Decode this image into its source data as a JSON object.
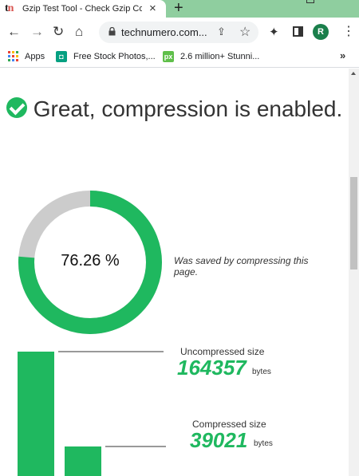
{
  "browser": {
    "tab": {
      "favicon_text": "tn",
      "title": "Gzip Test Tool - Check Gzip Co",
      "close_glyph": "×"
    },
    "new_tab_glyph": "+",
    "nav": {
      "back_glyph": "←",
      "forward_glyph": "→",
      "reload_glyph": "↻",
      "home_glyph": "⌂"
    },
    "url": "technumero.com...",
    "avatar_letter": "R",
    "bookmarks": [
      {
        "label": "Apps"
      },
      {
        "label": "Free Stock Photos,..."
      },
      {
        "label": "2.6 million+ Stunni..."
      }
    ],
    "bookmarks_more": "»"
  },
  "result": {
    "headline": "Great, compression is enabled.",
    "saved_percent_label": "76.26 %",
    "saved_note": "Was saved by compressing this page.",
    "uncompressed": {
      "label": "Uncompressed size",
      "value": "164357",
      "unit": "bytes"
    },
    "compressed": {
      "label": "Compressed size",
      "value": "39021",
      "unit": "bytes"
    }
  },
  "chart_data": [
    {
      "type": "pie",
      "categories": [
        "saved",
        "remaining"
      ],
      "values": [
        76.26,
        23.74
      ],
      "colors": [
        "#1fb85f",
        "#cccccc"
      ]
    },
    {
      "type": "bar",
      "categories": [
        "Uncompressed size",
        "Compressed size"
      ],
      "values": [
        164357,
        39021
      ],
      "color": "#1fb85f"
    }
  ],
  "colors": {
    "accent": "#1fb85f",
    "tabstrip": "#8fce9f",
    "track": "#cccccc"
  }
}
